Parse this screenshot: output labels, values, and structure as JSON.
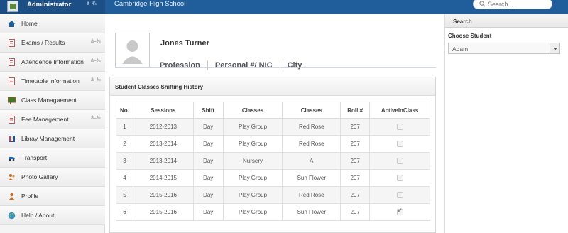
{
  "topbar": {
    "user_name": "Administrator",
    "user_caret": "â–¾",
    "school_name": "Cambridge High School",
    "search_placeholder": "Search..."
  },
  "sidebar": {
    "items": [
      {
        "label": "Home",
        "icon": "home-icon",
        "caret": ""
      },
      {
        "label": "Exams / Results",
        "icon": "document-icon",
        "caret": "â–¾"
      },
      {
        "label": "Attendence Information",
        "icon": "document-icon",
        "caret": "â–¾"
      },
      {
        "label": "Timetable Information",
        "icon": "document-icon",
        "caret": "â–¾"
      },
      {
        "label": "Class Managaement",
        "icon": "chalkboard-icon",
        "caret": ""
      },
      {
        "label": "Fee Management",
        "icon": "document-icon",
        "caret": "â–¾"
      },
      {
        "label": "Libray Management",
        "icon": "book-icon",
        "caret": ""
      },
      {
        "label": "Transport",
        "icon": "car-icon",
        "caret": ""
      },
      {
        "label": "Photo Gallary",
        "icon": "people-icon",
        "caret": ""
      },
      {
        "label": "Profile",
        "icon": "person-icon",
        "caret": ""
      },
      {
        "label": "Help / About",
        "icon": "globe-icon",
        "caret": ""
      }
    ]
  },
  "profile": {
    "name": "Jones Turner",
    "profession": "Profession",
    "personal_nic": "Personal #/ NIC",
    "city": "City"
  },
  "history": {
    "title": "Student Classes Shifting History",
    "columns": [
      "No.",
      "Sessions",
      "Shift",
      "Classes",
      "Classes",
      "Roll #",
      "ActiveInClass"
    ],
    "rows": [
      {
        "no": "1",
        "session": "2012-2013",
        "shift": "Day",
        "class": "Play Group",
        "section": "Red Rose",
        "roll": "207",
        "active": false
      },
      {
        "no": "2",
        "session": "2013-2014",
        "shift": "Day",
        "class": "Play Group",
        "section": "Red Rose",
        "roll": "207",
        "active": false
      },
      {
        "no": "3",
        "session": "2013-2014",
        "shift": "Day",
        "class": "Nursery",
        "section": "A",
        "roll": "207",
        "active": false
      },
      {
        "no": "4",
        "session": "2014-2015",
        "shift": "Day",
        "class": "Play Group",
        "section": "Sun Flower",
        "roll": "207",
        "active": false
      },
      {
        "no": "5",
        "session": "2015-2016",
        "shift": "Day",
        "class": "Play Group",
        "section": "Red Rose",
        "roll": "207",
        "active": false
      },
      {
        "no": "6",
        "session": "2015-2016",
        "shift": "Day",
        "class": "Play Group",
        "section": "Sun Flower",
        "roll": "207",
        "active": true
      }
    ]
  },
  "right_panel": {
    "search_label": "Search",
    "choose_label": "Choose Student",
    "selected_student": "Adam"
  },
  "colors": {
    "topbar": "#1f5e9b",
    "topbar_left": "#1b4f85"
  }
}
